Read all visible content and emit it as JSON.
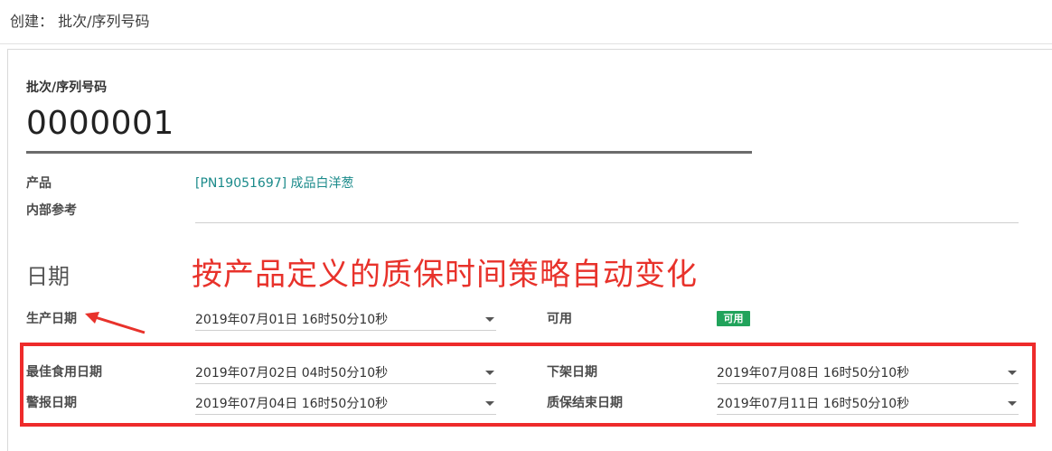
{
  "breadcrumb": "创建： 批次/序列号码",
  "lot": {
    "label": "批次/序列号码",
    "value": "0000001"
  },
  "product": {
    "label": "产品",
    "value": "[PN19051697] 成品白洋葱"
  },
  "internal_ref": {
    "label": "内部参考",
    "value": ""
  },
  "dates_section": {
    "title": "日期"
  },
  "annotation": {
    "text": "按产品定义的质保时间策略自动变化",
    "color": "#e8322b"
  },
  "production_date": {
    "label": "生产日期",
    "value": "2019年07月01日 16时50分10秒"
  },
  "availability": {
    "label": "可用",
    "badge": "可用",
    "badge_color": "#21a35b"
  },
  "best_before": {
    "label": "最佳食用日期",
    "value": "2019年07月02日 04时50分10秒"
  },
  "removal_date": {
    "label": "下架日期",
    "value": "2019年07月08日 16时50分10秒"
  },
  "alert_date": {
    "label": "警报日期",
    "value": "2019年07月04日 16时50分10秒"
  },
  "expiry_date": {
    "label": "质保结束日期",
    "value": "2019年07月11日 16时50分10秒"
  },
  "colors": {
    "link": "#1a8a8a",
    "highlight_box": "#ee2b2b"
  }
}
